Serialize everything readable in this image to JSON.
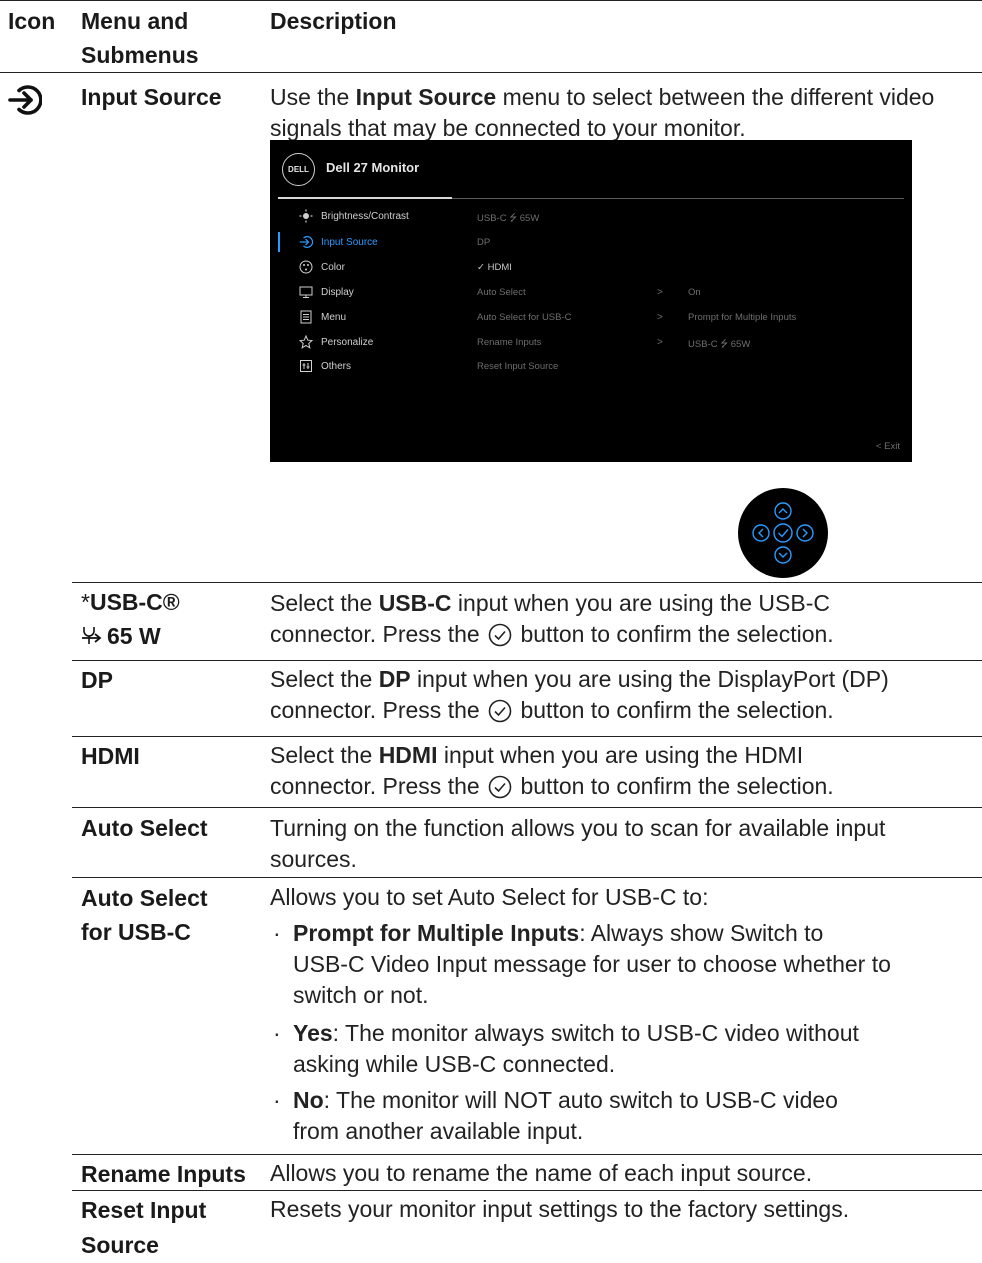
{
  "header": {
    "icon": "Icon",
    "menu": "Menu and Submenus",
    "menu_l1": "Menu and",
    "menu_l2": "Submenus",
    "description": "Description"
  },
  "input_source": {
    "name": "Input Source",
    "icon": "input-source-icon",
    "desc_pre": "Use the ",
    "desc_bold": "Input Source",
    "desc_post": " menu to select between the different video signals that may be connected to your monitor."
  },
  "osd": {
    "logo": "DELL",
    "title": "Dell 27 Monitor",
    "menu_items": [
      {
        "label": "Brightness/Contrast",
        "icon": "brightness-icon"
      },
      {
        "label": "Input Source",
        "icon": "input-source-icon",
        "active": true
      },
      {
        "label": "Color",
        "icon": "color-palette-icon"
      },
      {
        "label": "Display",
        "icon": "display-icon"
      },
      {
        "label": "Menu",
        "icon": "menu-icon"
      },
      {
        "label": "Personalize",
        "icon": "star-icon"
      },
      {
        "label": "Others",
        "icon": "others-icon"
      }
    ],
    "submenu": [
      {
        "label": "USB-C ⭍ 65W",
        "arrow": "",
        "value": ""
      },
      {
        "label": "DP",
        "arrow": "",
        "value": ""
      },
      {
        "label": "✓ HDMI",
        "arrow": "",
        "value": ""
      },
      {
        "label": "Auto Select",
        "arrow": ">",
        "value": "On"
      },
      {
        "label": "Auto Select for USB-C",
        "arrow": ">",
        "value": "Prompt for Multiple Inputs"
      },
      {
        "label": "Rename Inputs",
        "arrow": ">",
        "value": "USB-C ⭍ 65W"
      },
      {
        "label": "Reset Input Source",
        "arrow": "",
        "value": ""
      }
    ],
    "exit": "<  Exit"
  },
  "rows": {
    "usbc": {
      "name_l1": "USB-C®",
      "name_l2": "65 W",
      "d1_pre": "Select the ",
      "d1_bold": "USB-C",
      "d1_post": " input when you are using the USB-C",
      "d2_pre": "connector. Press the ",
      "d2_post": " button to confirm the selection."
    },
    "dp": {
      "name": "DP",
      "d1_pre": "Select the ",
      "d1_bold": "DP",
      "d1_post": " input when you are using the DisplayPort (DP)",
      "d2_pre": "connector. Press the ",
      "d2_post": " button to confirm the selection."
    },
    "hdmi": {
      "name": "HDMI",
      "d1_pre": "Select the ",
      "d1_bold": "HDMI",
      "d1_post": " input when you are using the HDMI",
      "d2_pre": "connector. Press the ",
      "d2_post": " button to confirm the selection."
    },
    "auto_select": {
      "name": "Auto Select",
      "d1": "Turning on the function allows you to scan for available input",
      "d2": "sources."
    },
    "auto_select_usbc": {
      "name_l1": "Auto Select",
      "name_l2": "for USB-C",
      "intro": "Allows you to set Auto Select for USB-C to:",
      "b1_bold": "Prompt for Multiple Inputs",
      "b1_l1": ": Always show Switch to",
      "b1_l2": "USB-C Video Input message for user to choose whether to",
      "b1_l3": "switch or not.",
      "b2_bold": "Yes",
      "b2_l1": ": The monitor always switch to USB-C video without",
      "b2_l2": "asking while USB-C connected.",
      "b3_bold": "No",
      "b3_l1": ": The monitor will NOT auto switch to USB-C video",
      "b3_l2": "from another available input."
    },
    "rename": {
      "name": "Rename Inputs",
      "d1": "Allows you to rename the name of each input source."
    },
    "reset": {
      "name_l1": "Reset Input",
      "name_l2": "Source",
      "d1": "Resets your monitor input settings to the factory settings."
    }
  }
}
